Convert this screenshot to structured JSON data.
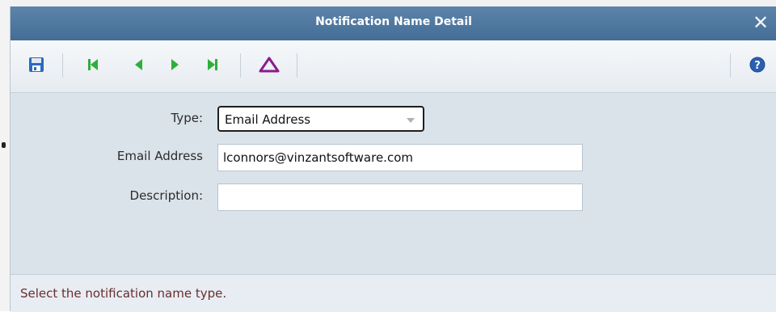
{
  "dialog": {
    "title": "Notification Name Detail",
    "close_glyph": "✕"
  },
  "toolbar": {
    "buttons": [
      {
        "name": "save-icon",
        "color": "#2a6bbd"
      },
      {
        "name": "first-record-icon",
        "color": "#2fae3a"
      },
      {
        "name": "previous-record-icon",
        "color": "#2fae3a"
      },
      {
        "name": "next-record-icon",
        "color": "#2fae3a"
      },
      {
        "name": "last-record-icon",
        "color": "#2fae3a"
      },
      {
        "name": "delta-icon",
        "color": "#8a1b8f"
      },
      {
        "name": "help-icon",
        "color": "#2a5fb0"
      }
    ]
  },
  "form": {
    "type_label": "Type:",
    "type_value": "Email Address",
    "email_label": "Email Address",
    "email_value": "lconnors@vinzantsoftware.com",
    "description_label": "Description:",
    "description_value": ""
  },
  "status": {
    "message": "Select the notification name type."
  }
}
